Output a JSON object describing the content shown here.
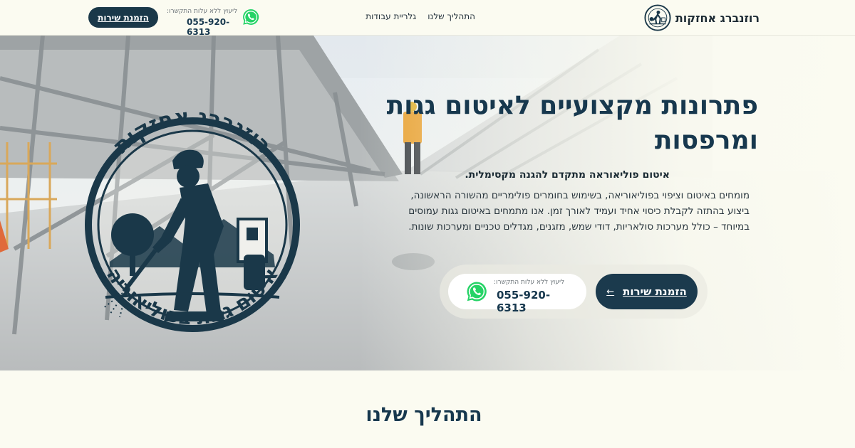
{
  "header": {
    "brand_name": "רוזנברג אחזקות",
    "nav": [
      {
        "label": "התהליך שלנו"
      },
      {
        "label": "גלריית עבודות"
      }
    ],
    "contact_caption": "ליעוץ ללא עלות התקשרו:",
    "phone": "055-920-6313",
    "book_button": "הזמנת שירות"
  },
  "hero": {
    "title": "פתרונות מקצועיים לאיטום גגות ומרפסות",
    "subtitle": "איטום פוליאוראה מתקדם להגנה מקסימלית.",
    "description": "מומחים באיטום וציפוי בפוליאוריאה, בשימוש בחומרים פולימריים מהשורה הראשונה, ביצוע בהתזה לקבלת כיסוי אחיד ועמיד לאורך זמן. אנו מתמחים באיטום גגות עמוסים במיוחד – כולל מערכות סולאריות, דודי שמש, מזגנים, מגדלים טכניים ומערכות שונות.",
    "cta_service": "הזמנת שירות",
    "cta_caption": "ליעוץ ללא עלות התקשרו:",
    "cta_phone": "055-920-6313",
    "emblem_top_text": "רוזנברג אחזקות",
    "emblem_bottom_text": "איטום גגות בפוליאוריה"
  },
  "section": {
    "title": "התהליך שלנו"
  },
  "colors": {
    "primary": "#17384e",
    "button_dark": "#1b3a4d",
    "page_bg": "#fbfbf1",
    "whatsapp": "#25d366"
  },
  "icons": {
    "whatsapp": "whatsapp-icon",
    "arrow": "arrow-left-icon",
    "logo": "roofer-logo-icon"
  }
}
